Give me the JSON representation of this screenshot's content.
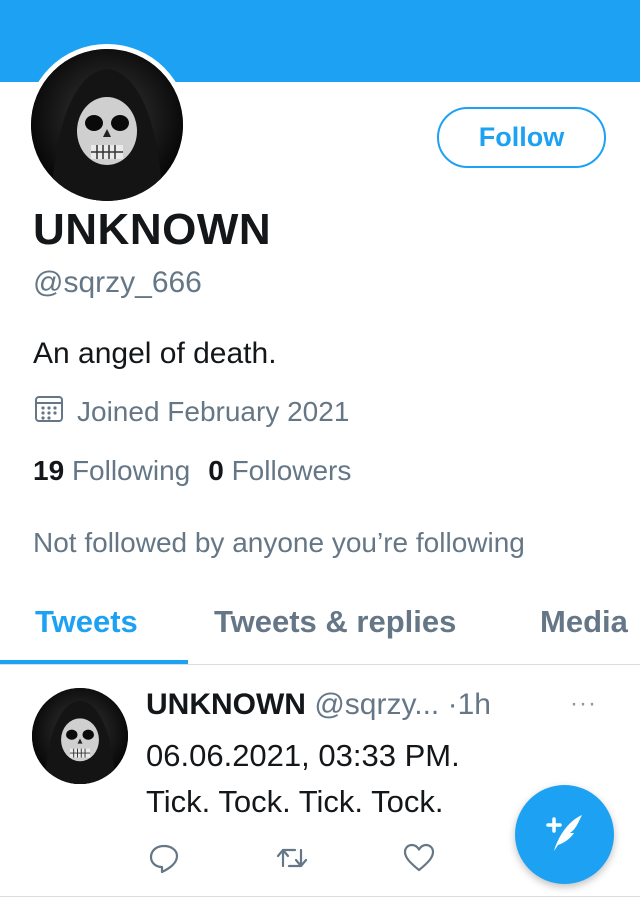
{
  "profile": {
    "name": "UNKNOWN",
    "handle": "@sqrzy_666",
    "bio": "An angel of death.",
    "joined": "Joined February 2021",
    "following_count": "19",
    "following_label": "Following",
    "followers_count": "0",
    "followers_label": "Followers",
    "not_followed": "Not followed by anyone you’re following",
    "follow_label": "Follow"
  },
  "tabs": [
    {
      "label": "Tweets",
      "active": true
    },
    {
      "label": "Tweets & replies",
      "active": false
    },
    {
      "label": "Media",
      "active": false
    }
  ],
  "tweet": {
    "name": "UNKNOWN",
    "handle": "@sqrzy...",
    "time": "·1h",
    "more": "···",
    "line1": "06.06.2021, 03:33 PM.",
    "line2": "Tick. Tock. Tick. Tock."
  },
  "icons": [
    "calendar-icon",
    "reply-icon",
    "retweet-icon",
    "like-icon",
    "more-icon",
    "compose-tweet-icon"
  ],
  "colors": {
    "accent": "#1da1f2",
    "muted": "#657786",
    "text": "#14171a"
  }
}
